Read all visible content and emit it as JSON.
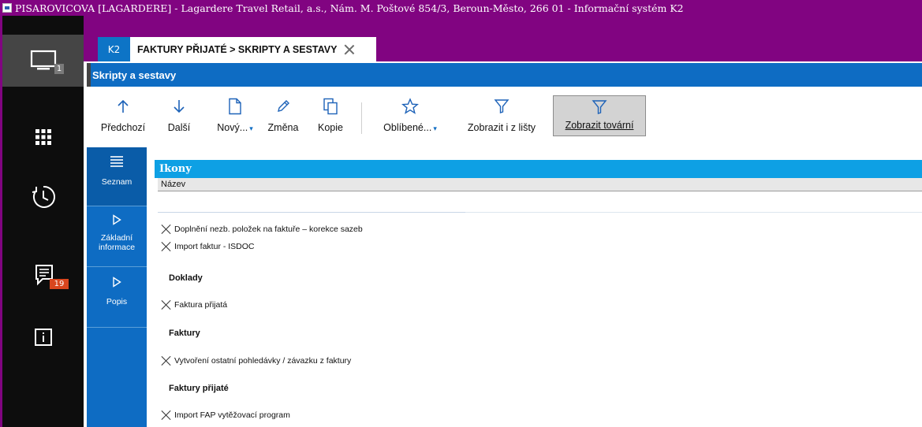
{
  "window": {
    "app_icon_text": "K2",
    "title": "PISAROVICOVA [LAGARDERE] - Lagardere Travel Retail, a.s., Nám. M. Poštové 854/3, Beroun-Město, 266 01 - Informační systém K2"
  },
  "rail": {
    "items": [
      {
        "icon": "monitor-icon",
        "badge": "1"
      },
      {
        "icon": "apps-grid-icon"
      },
      {
        "icon": "history-icon"
      },
      {
        "icon": "messages-icon",
        "badge": "19"
      },
      {
        "icon": "info-icon"
      }
    ],
    "colors": {
      "background": "#0d0d0d",
      "active": "#454545",
      "badge": "#d9461e"
    }
  },
  "tabs": {
    "k2_label": "K2",
    "active_label": "FAKTURY PŘIJATÉ > SKRIPTY A SESTAVY"
  },
  "module": {
    "title": "Skripty a sestavy"
  },
  "toolbar": {
    "buttons": [
      {
        "label": "Předchozí",
        "icon": "arrow-up-icon"
      },
      {
        "label": "Další",
        "icon": "arrow-down-icon"
      },
      {
        "label": "Nový...",
        "icon": "new-document-icon",
        "dropdown": true
      },
      {
        "label": "Změna",
        "icon": "pencil-icon"
      },
      {
        "label": "Kopie",
        "icon": "copy-icon"
      },
      {
        "label": "Oblíbené...",
        "icon": "star-icon",
        "dropdown": true
      },
      {
        "label": "Zobrazit i z lišty",
        "icon": "filter-icon"
      },
      {
        "label": "Zobrazit tovární",
        "icon": "filter-icon",
        "pressed": true
      }
    ]
  },
  "side_panel": {
    "items": [
      {
        "label": "Seznam",
        "icon": "list-icon",
        "active": true
      },
      {
        "label": "Základní informace",
        "icon": "play-icon"
      },
      {
        "label": "Popis",
        "icon": "play-icon"
      }
    ]
  },
  "content": {
    "header": "Ikony",
    "column_name": "Název",
    "rows": {
      "r1": "Doplnění nezb. položek na faktuře – korekce sazeb",
      "r2": "Import faktur - ISDOC",
      "g1": "Doklady",
      "r3": "Faktura přijatá",
      "g2": "Faktury",
      "r4": "Vytvoření ostatní pohledávky / závazku z faktury",
      "g3": "Faktury přijaté",
      "r5": "Import FAP vytěžovací program"
    }
  },
  "colors": {
    "accent_purple": "#810481",
    "module_blue": "#0e6cc3",
    "content_header_blue": "#0ea0e4"
  }
}
